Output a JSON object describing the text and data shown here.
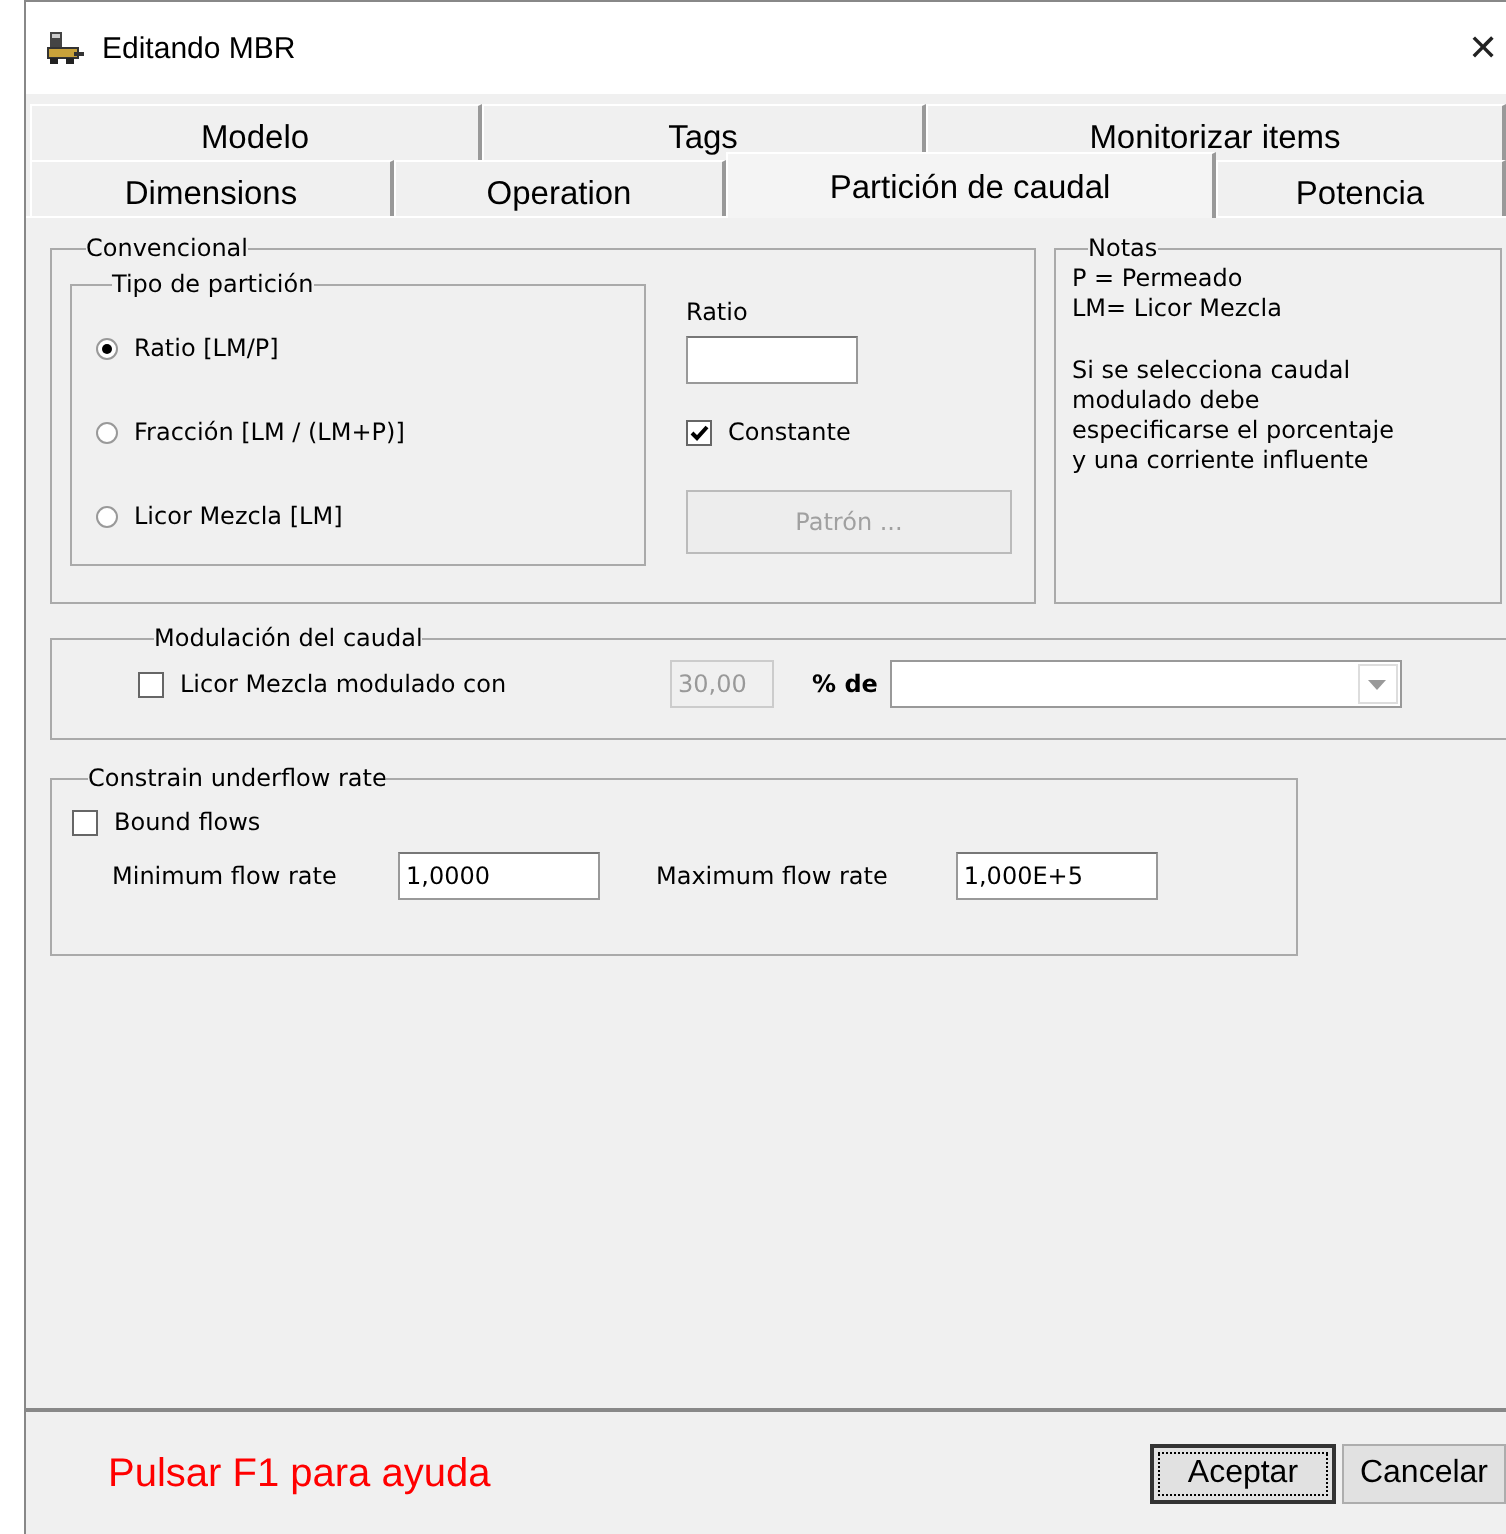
{
  "window": {
    "title": "Editando MBR",
    "close": "✕"
  },
  "tab_rows": [
    [
      {
        "label": "Modelo",
        "selected": false
      },
      {
        "label": "Tags",
        "selected": false
      },
      {
        "label": "Monitorizar items",
        "selected": false
      }
    ],
    [
      {
        "label": "Dimensions",
        "selected": false
      },
      {
        "label": "Operation",
        "selected": false
      },
      {
        "label": "Partición de caudal",
        "selected": true
      },
      {
        "label": "Potencia",
        "selected": false
      }
    ]
  ],
  "convencional": {
    "title": "Convencional",
    "tipo": {
      "title": "Tipo de partición",
      "options": [
        {
          "label": "Ratio [LM/P]",
          "selected": true
        },
        {
          "label": "Fracción [LM / (LM+P)]",
          "selected": false
        },
        {
          "label": "Licor Mezcla [LM]",
          "selected": false
        }
      ]
    },
    "ratio_label": "Ratio",
    "constante": {
      "label": "Constante",
      "checked": true
    },
    "patron": {
      "label": "Patrón ...",
      "disabled": true
    }
  },
  "notas": {
    "title": "Notas",
    "lines": [
      "P = Permeado",
      "LM= Licor Mezcla"
    ],
    "paragraph": [
      "Si se selecciona caudal",
      "modulado debe",
      "especificarse el porcentaje",
      "y una corriente influente"
    ]
  },
  "modulacion": {
    "title": "Modulación del caudal",
    "check": {
      "label": "Licor Mezcla modulado con",
      "checked": false
    },
    "value": "30,00",
    "disabled": true,
    "pct_label": "% de"
  },
  "constrain": {
    "title": "Constrain underflow rate",
    "check": {
      "label": "Bound flows",
      "checked": false
    },
    "min_label": "Minimum flow rate",
    "min_value": "1,0000",
    "max_label": "Maximum flow rate",
    "max_value": "1,000E+5"
  },
  "footer": {
    "help": "Pulsar F1 para ayuda",
    "buttons": [
      {
        "label": "Aceptar",
        "focused": true
      },
      {
        "label": "Cancelar",
        "focused": false
      }
    ]
  }
}
